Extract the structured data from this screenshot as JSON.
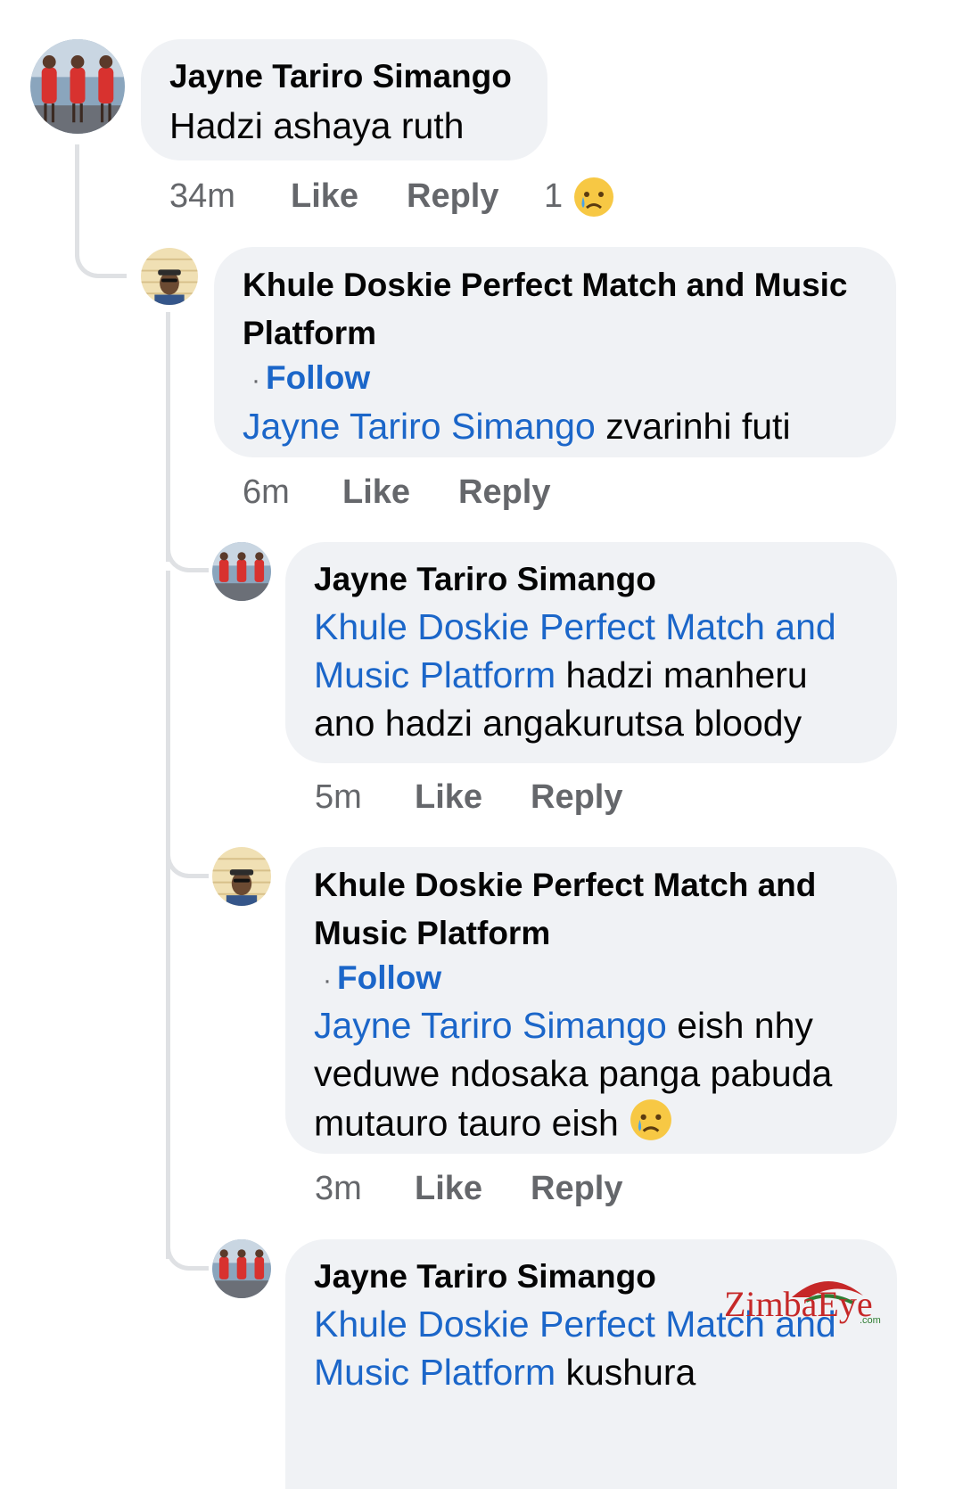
{
  "comments": [
    {
      "author": "Jayne Tariro Simango",
      "text": "Hadzi ashaya ruth",
      "time": "34m",
      "like": "Like",
      "reply": "Reply",
      "reaction_count": "1",
      "reaction_icon": "crying-emoji"
    },
    {
      "author": "Khule Doskie Perfect Match and Music Platform",
      "follow": "Follow",
      "mention": "Jayne Tariro Simango",
      "text": " zvarinhi futi",
      "time": "6m",
      "like": "Like",
      "reply": "Reply"
    },
    {
      "author": "Jayne Tariro Simango",
      "mention_line1": "Khule Doskie Perfect Match and",
      "mention_line2": "Music Platform",
      "text": " hadzi manheru",
      "text_line3": "ano hadzi angakurutsa bloody",
      "time": "5m",
      "like": "Like",
      "reply": "Reply"
    },
    {
      "author_line1": "Khule Doskie Perfect Match and",
      "author_line2": "Music Platform",
      "follow": "Follow",
      "mention": "Jayne Tariro Simango",
      "text": " eish nhy",
      "text_line2": "veduwe ndosaka panga pabuda",
      "text_line3": "mutauro tauro eish ",
      "emoji": "crying-emoji",
      "time": "3m",
      "like": "Like",
      "reply": "Reply"
    },
    {
      "author": "Jayne Tariro Simango",
      "mention_line1": "Khule Doskie Perfect Match and",
      "mention_line2": "Music Platform",
      "text": " kushura"
    }
  ],
  "watermark": {
    "text": "ZimbaEye",
    "suffix": ".com"
  },
  "colors": {
    "bubble": "#f0f2f5",
    "mention": "#1b66c9",
    "meta": "#65676b",
    "thread": "#dfe1e4"
  }
}
